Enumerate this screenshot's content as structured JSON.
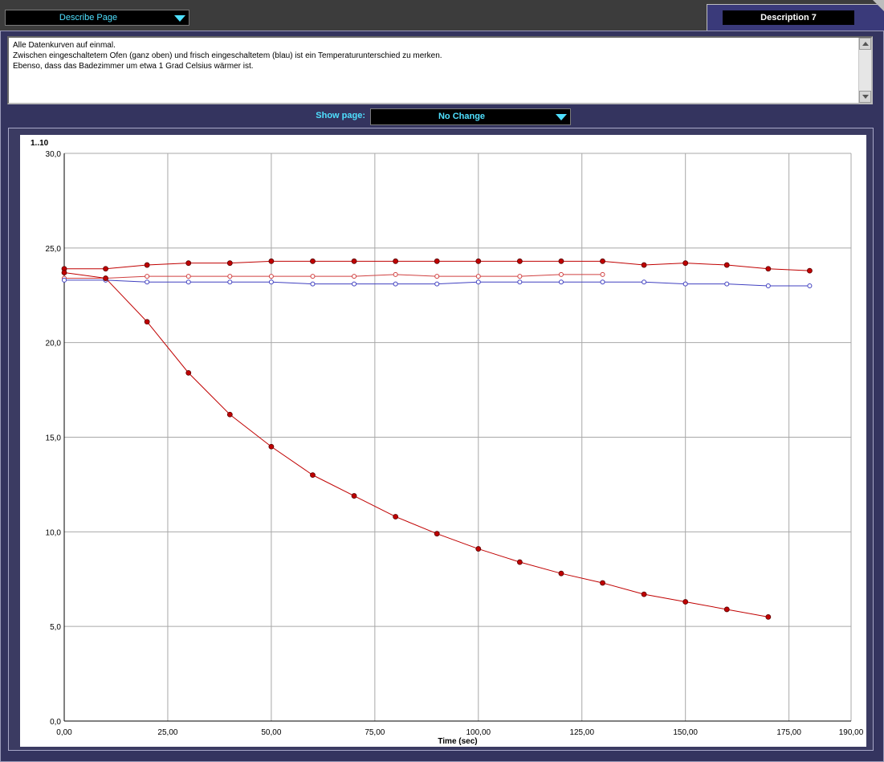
{
  "top": {
    "describe_page_label": "Describe Page",
    "description_tab_label": "Description 7"
  },
  "description": {
    "lines": [
      "Alle Datenkurven auf einmal.",
      "Zwischen eingeschaltetem Ofen (ganz oben) und frisch eingeschaltetem (blau) ist ein Temperaturunterschied zu merken.",
      "Ebenso, dass das Badezimmer um etwa 1 Grad Celsius wärmer ist."
    ]
  },
  "show_page": {
    "label": "Show page:",
    "value": "No Change"
  },
  "chart_data": {
    "type": "line",
    "ylabel": "1..10",
    "xlabel": "Time (sec)",
    "xlim": [
      0,
      190
    ],
    "ylim": [
      0,
      30
    ],
    "grid": true,
    "x_ticks": [
      "0,00",
      "25,00",
      "50,00",
      "75,00",
      "100,00",
      "125,00",
      "150,00",
      "175,00",
      "190,00"
    ],
    "x_tick_values": [
      0,
      25,
      50,
      75,
      100,
      125,
      150,
      175,
      190
    ],
    "y_ticks": [
      "0,0",
      "5,0",
      "10,0",
      "15,0",
      "20,0",
      "25,0",
      "30,0"
    ],
    "y_tick_values": [
      0,
      5,
      10,
      15,
      20,
      25,
      30
    ],
    "series": [
      {
        "color": "#c00000",
        "marker": "filled",
        "points": [
          [
            0,
            23.9
          ],
          [
            10,
            23.9
          ],
          [
            20,
            24.1
          ],
          [
            30,
            24.2
          ],
          [
            40,
            24.2
          ],
          [
            50,
            24.3
          ],
          [
            60,
            24.3
          ],
          [
            70,
            24.3
          ],
          [
            80,
            24.3
          ],
          [
            90,
            24.3
          ],
          [
            100,
            24.3
          ],
          [
            110,
            24.3
          ],
          [
            120,
            24.3
          ],
          [
            130,
            24.3
          ],
          [
            140,
            24.1
          ],
          [
            150,
            24.2
          ],
          [
            160,
            24.1
          ],
          [
            170,
            23.9
          ],
          [
            180,
            23.8
          ]
        ]
      },
      {
        "color": "#d04040",
        "marker": "hollow",
        "points": [
          [
            0,
            23.4
          ],
          [
            10,
            23.4
          ],
          [
            20,
            23.5
          ],
          [
            30,
            23.5
          ],
          [
            40,
            23.5
          ],
          [
            50,
            23.5
          ],
          [
            60,
            23.5
          ],
          [
            70,
            23.5
          ],
          [
            80,
            23.6
          ],
          [
            90,
            23.5
          ],
          [
            100,
            23.5
          ],
          [
            110,
            23.5
          ],
          [
            120,
            23.6
          ],
          [
            130,
            23.6
          ]
        ]
      },
      {
        "color": "#4040c0",
        "marker": "hollow",
        "points": [
          [
            0,
            23.3
          ],
          [
            10,
            23.3
          ],
          [
            20,
            23.2
          ],
          [
            30,
            23.2
          ],
          [
            40,
            23.2
          ],
          [
            50,
            23.2
          ],
          [
            60,
            23.1
          ],
          [
            70,
            23.1
          ],
          [
            80,
            23.1
          ],
          [
            90,
            23.1
          ],
          [
            100,
            23.2
          ],
          [
            110,
            23.2
          ],
          [
            120,
            23.2
          ],
          [
            130,
            23.2
          ],
          [
            140,
            23.2
          ],
          [
            150,
            23.1
          ],
          [
            160,
            23.1
          ],
          [
            170,
            23.0
          ],
          [
            180,
            23.0
          ]
        ]
      },
      {
        "color": "#c00000",
        "marker": "filled",
        "points": [
          [
            0,
            23.7
          ],
          [
            10,
            23.4
          ],
          [
            20,
            21.1
          ],
          [
            30,
            18.4
          ],
          [
            40,
            16.2
          ],
          [
            50,
            14.5
          ],
          [
            60,
            13.0
          ],
          [
            70,
            11.9
          ],
          [
            80,
            10.8
          ],
          [
            90,
            9.9
          ],
          [
            100,
            9.1
          ],
          [
            110,
            8.4
          ],
          [
            120,
            7.8
          ],
          [
            130,
            7.3
          ],
          [
            140,
            6.7
          ],
          [
            150,
            6.3
          ],
          [
            160,
            5.9
          ],
          [
            170,
            5.5
          ]
        ]
      }
    ]
  }
}
